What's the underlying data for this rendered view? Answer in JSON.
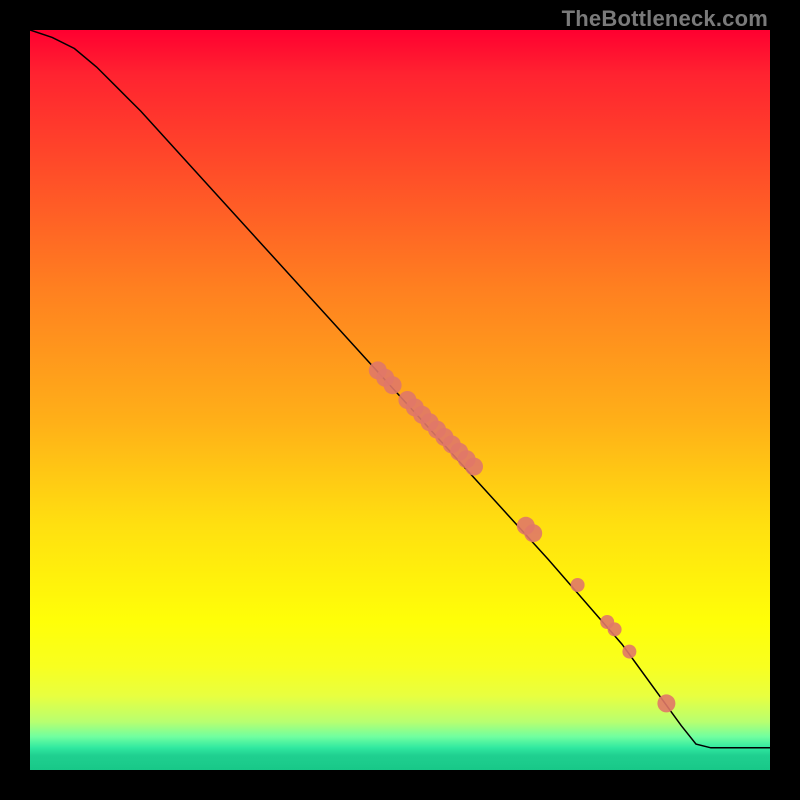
{
  "watermark": "TheBottleneck.com",
  "colors": {
    "frame": "#000000",
    "curve": "#000000",
    "dot": "#e07868",
    "gradient_top": "#ff0030",
    "gradient_mid": "#ffff08",
    "gradient_bottom": "#18c888"
  },
  "chart_data": {
    "type": "line",
    "title": "",
    "xlabel": "",
    "ylabel": "",
    "xlim": [
      0,
      100
    ],
    "ylim": [
      0,
      100
    ],
    "grid": false,
    "legend": false,
    "series": [
      {
        "name": "curve",
        "kind": "line",
        "x": [
          0,
          3,
          6,
          9,
          12,
          15,
          20,
          30,
          40,
          50,
          60,
          70,
          80,
          88,
          90,
          92,
          100
        ],
        "y": [
          100,
          99,
          97.5,
          95,
          92,
          89,
          83.5,
          72.5,
          61.5,
          50.5,
          39.5,
          28.5,
          17,
          6,
          3.5,
          3,
          3
        ]
      },
      {
        "name": "points",
        "kind": "scatter",
        "x": [
          47,
          48,
          49,
          51,
          52,
          53,
          54,
          55,
          56,
          57,
          58,
          59,
          60,
          67,
          68,
          74,
          78,
          79,
          81,
          86
        ],
        "y": [
          54,
          53,
          52,
          50,
          49,
          48,
          47,
          46,
          45,
          44,
          43,
          42,
          41,
          33,
          32,
          25,
          20,
          19,
          16,
          9
        ],
        "r": [
          9,
          9,
          9,
          9,
          9,
          9,
          9,
          9,
          9,
          9,
          9,
          9,
          9,
          9,
          9,
          7,
          7,
          7,
          7,
          9
        ]
      }
    ]
  }
}
